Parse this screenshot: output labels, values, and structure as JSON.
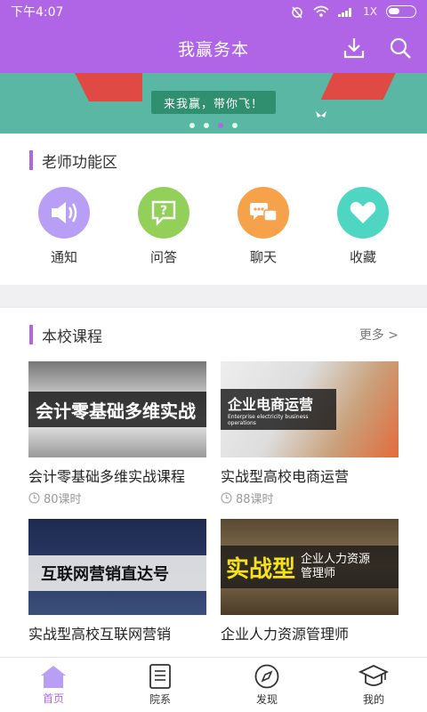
{
  "status": {
    "time": "下午4:07",
    "signal_text": "1X"
  },
  "appbar": {
    "title": "我赢务本",
    "download_icon": "download-icon",
    "search_icon": "search-icon"
  },
  "banner": {
    "ribbon_text": "来我赢，带你飞！",
    "slides": 4,
    "active_slide": 3
  },
  "teacher": {
    "title": "老师功能区",
    "items": [
      {
        "label": "通知",
        "icon": "speaker-icon",
        "color": "#b99ef5"
      },
      {
        "label": "问答",
        "icon": "question-chat-icon",
        "color": "#92d05a"
      },
      {
        "label": "聊天",
        "icon": "chat-bubbles-icon",
        "color": "#f5a24a"
      },
      {
        "label": "收藏",
        "icon": "heart-icon",
        "color": "#4fd6c2"
      }
    ]
  },
  "school": {
    "title": "本校课程",
    "more": "更多 >",
    "courses": [
      {
        "thumb_text": "会计零基础多维实战",
        "title": "会计零基础多维实战课程",
        "hours": "80课时"
      },
      {
        "thumb_text": "企业电商运营",
        "thumb_sub": "Enterprise electricity business operations",
        "title": "实战型高校电商运营",
        "hours": "88课时"
      },
      {
        "thumb_text": "互联网营销直达号",
        "title": "实战型高校互联网营销",
        "hours": ""
      },
      {
        "thumb_text": "实战型",
        "thumb_sub": "企业人力资源管理师",
        "title": "企业人力资源管理师",
        "hours": ""
      }
    ]
  },
  "tabs": [
    {
      "label": "首页",
      "icon": "home-icon"
    },
    {
      "label": "院系",
      "icon": "list-doc-icon"
    },
    {
      "label": "发现",
      "icon": "compass-icon"
    },
    {
      "label": "我的",
      "icon": "graduation-cap-icon"
    }
  ]
}
